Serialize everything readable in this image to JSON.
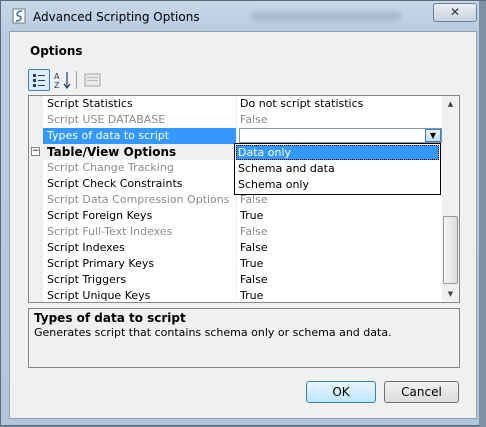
{
  "window": {
    "title": "Advanced Scripting Options",
    "close_glyph": "✕"
  },
  "options_label": "Options",
  "toolbar": {
    "categorized_icon": "categorized-icon",
    "alphabetical_icon": "alphabetical-sort-icon",
    "property_pages_icon": "property-pages-icon"
  },
  "grid": {
    "rows": [
      {
        "name": "Script Statistics",
        "value": "Do not script statistics",
        "enabled": true
      },
      {
        "name": "Script USE DATABASE",
        "value": "False",
        "enabled": false
      },
      {
        "name": "Types of data to script",
        "value": "Data only",
        "enabled": true,
        "selected": true
      },
      {
        "category": "Table/View Options",
        "expanded_glyph": "−"
      },
      {
        "name": "Script Change Tracking",
        "value": "",
        "enabled": false
      },
      {
        "name": "Script Check Constraints",
        "value": "",
        "enabled": true
      },
      {
        "name": "Script Data Compression Options",
        "value": "False",
        "enabled": false
      },
      {
        "name": "Script Foreign Keys",
        "value": "True",
        "enabled": true
      },
      {
        "name": "Script Full-Text Indexes",
        "value": "False",
        "enabled": false
      },
      {
        "name": "Script Indexes",
        "value": "False",
        "enabled": true
      },
      {
        "name": "Script Primary Keys",
        "value": "True",
        "enabled": true
      },
      {
        "name": "Script Triggers",
        "value": "False",
        "enabled": true
      },
      {
        "name": "Script Unique Keys",
        "value": "True",
        "enabled": true
      }
    ],
    "combo_arrow": "▼"
  },
  "dropdown": {
    "options": [
      "Data only",
      "Schema and data",
      "Schema only"
    ],
    "selected_index": 0
  },
  "scrollbar": {
    "up": "▲",
    "down": "▼"
  },
  "description": {
    "title": "Types of data to script",
    "text": "Generates script that contains schema only or schema and data."
  },
  "buttons": {
    "ok": "OK",
    "cancel": "Cancel"
  },
  "colors": {
    "selection": "#3399ff",
    "disabled_text": "#8d8d8d"
  }
}
